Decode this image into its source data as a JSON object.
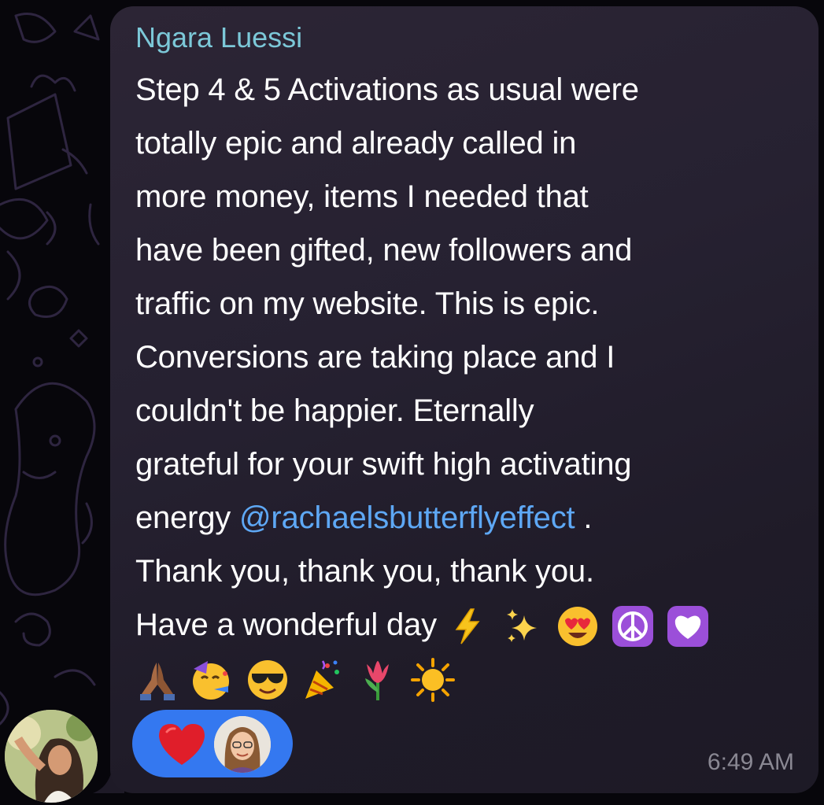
{
  "message": {
    "sender_name": "Ngara Luessi",
    "lines": [
      "Step 4 & 5 Activations as usual were",
      "totally epic and already called in",
      "more money, items I needed that",
      "have been gifted, new followers and",
      "traffic on my website. This is epic.",
      "Conversions are taking place and I",
      "couldn't be happier. Eternally",
      "grateful for your swift high activating"
    ],
    "line9_prefix": "energy ",
    "mention": "@rachaelsbutterflyeffect",
    "line9_suffix": " .",
    "line10": "Thank you, thank you, thank you.",
    "line11_text": "Have a wonderful day",
    "emojis_line11": [
      "lightning-emoji",
      "sparkles-emoji",
      "heart-eyes-emoji",
      "peace-sign-emoji",
      "white-heart-emoji"
    ],
    "emojis_line12": [
      "praying-hands-emoji",
      "partying-face-emoji",
      "sunglasses-emoji",
      "party-popper-emoji",
      "tulip-emoji",
      "sun-emoji"
    ],
    "time": "6:49 AM"
  },
  "reactions": {
    "emoji": "red-heart-icon",
    "reactor": "reactor-avatar"
  },
  "colors": {
    "sender_name": "#7cc8d8",
    "mention": "#5ea8f5",
    "reaction_pill": "#3478f0",
    "bubble": "#262131",
    "timestamp": "#8a8893"
  }
}
